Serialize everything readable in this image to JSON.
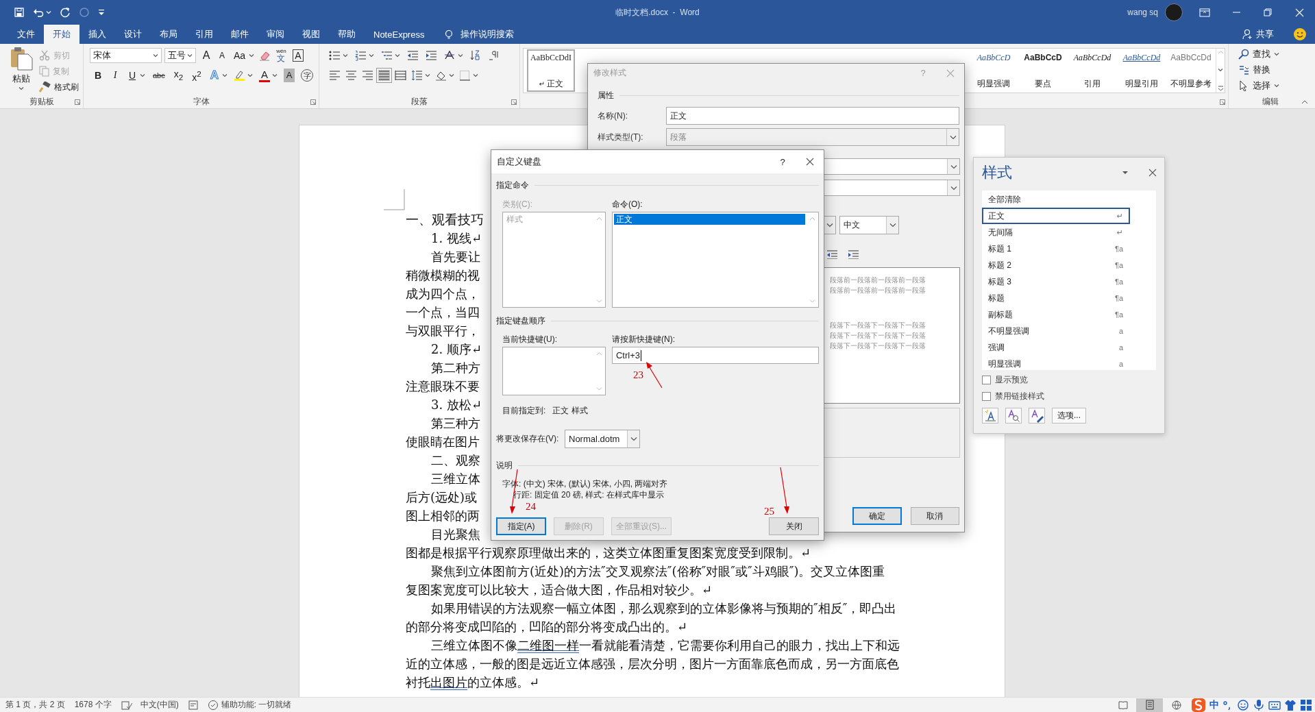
{
  "window": {
    "title": "临时文档.docx  -  Word",
    "user": "wang sq"
  },
  "tabs": [
    {
      "label": "文件",
      "selected": false
    },
    {
      "label": "开始",
      "selected": true
    },
    {
      "label": "插入",
      "selected": false
    },
    {
      "label": "设计",
      "selected": false
    },
    {
      "label": "布局",
      "selected": false
    },
    {
      "label": "引用",
      "selected": false
    },
    {
      "label": "邮件",
      "selected": false
    },
    {
      "label": "审阅",
      "selected": false
    },
    {
      "label": "视图",
      "selected": false
    },
    {
      "label": "帮助",
      "selected": false
    },
    {
      "label": "NoteExpress",
      "selected": false
    }
  ],
  "tell_me": "操作说明搜索",
  "share": "共享",
  "ribbon": {
    "clipboard": {
      "label": "剪贴板",
      "paste": "粘贴",
      "tools": [
        {
          "kind": "cut",
          "label": "剪切",
          "disabled": true
        },
        {
          "kind": "copy",
          "label": "复制",
          "disabled": true
        },
        {
          "kind": "painter",
          "label": "格式刷",
          "disabled": false
        }
      ]
    },
    "font": {
      "label": "字体",
      "name": "宋体",
      "size": "五号",
      "row1": [
        {
          "kind": "grow",
          "glyph": "A"
        },
        {
          "kind": "shrink",
          "glyph": "A"
        },
        {
          "kind": "case",
          "glyph": "Aa"
        },
        {
          "kind": "clear"
        },
        {
          "kind": "phonetic",
          "glyph": "wén",
          "base": "文"
        },
        {
          "kind": "border",
          "glyph": "A"
        }
      ],
      "row2": [
        {
          "kind": "bold",
          "glyph": "B"
        },
        {
          "kind": "italic",
          "glyph": "I"
        },
        {
          "kind": "underline",
          "glyph": "U"
        },
        {
          "kind": "strike",
          "glyph": "abc"
        },
        {
          "kind": "sub",
          "glyph": "x$_{2}$"
        },
        {
          "kind": "sup",
          "glyph": "x$^{2}$"
        },
        {
          "kind": "effects",
          "glyph": "A"
        },
        {
          "kind": "highlight"
        },
        {
          "kind": "color",
          "glyph": "A"
        },
        {
          "kind": "shading",
          "glyph": "A"
        },
        {
          "kind": "enclose",
          "glyph": "字"
        }
      ]
    },
    "paragraph": {
      "label": "段落",
      "alignments": [
        {
          "selected": false
        },
        {
          "selected": false
        },
        {
          "selected": false
        },
        {
          "selected": true
        },
        {
          "selected": false
        }
      ]
    },
    "styles": [
      {
        "kind": "normal",
        "sample": "AaBbCcDdI",
        "mark": "↵",
        "label": "正文",
        "selected": true
      },
      {
        "kind": "emphasis",
        "sample": "AaBbCcD",
        "label": "明显强调",
        "selected": false
      },
      {
        "kind": "strong",
        "sample": "AaBbCcD",
        "label": "要点",
        "selected": false
      },
      {
        "kind": "quote",
        "sample": "AaBbCcDd",
        "label": "引用",
        "selected": false
      },
      {
        "kind": "intense_quote",
        "sample": "AaBbCcDd",
        "label": "明显引用",
        "selected": false
      },
      {
        "kind": "subtle_ref",
        "sample": "AaBbCcDd",
        "label": "不明显参考",
        "selected": false
      }
    ],
    "editing": {
      "label": "编辑",
      "tools": [
        {
          "kind": "find",
          "label": "查找"
        },
        {
          "kind": "replace",
          "label": "替换"
        },
        {
          "kind": "select",
          "label": "选择"
        }
      ]
    }
  },
  "document": {
    "lines": [
      {
        "kind": "heading",
        "parts": [
          {
            "text": "一、观看技巧"
          }
        ]
      },
      {
        "kind": "indent",
        "parts": [
          {
            "text": "1. 视线↵"
          }
        ]
      },
      {
        "kind": "indent",
        "parts": [
          {
            "text": "首先要让"
          }
        ]
      },
      {
        "kind": "plain",
        "parts": [
          {
            "text": "稍微模糊的视"
          }
        ]
      },
      {
        "kind": "plain",
        "parts": [
          {
            "text": "成为四个点，"
          }
        ]
      },
      {
        "kind": "plain",
        "parts": [
          {
            "text": "一个点，当四"
          }
        ]
      },
      {
        "kind": "plain",
        "parts": [
          {
            "text": "与双眼平行，"
          }
        ]
      },
      {
        "kind": "indent",
        "parts": [
          {
            "text": "2. 顺序↵"
          }
        ]
      },
      {
        "kind": "indent",
        "parts": [
          {
            "text": "第二种方"
          }
        ]
      },
      {
        "kind": "plain",
        "parts": [
          {
            "text": "注意眼珠不要"
          }
        ]
      },
      {
        "kind": "indent",
        "parts": [
          {
            "text": "3. 放松↵"
          }
        ]
      },
      {
        "kind": "indent",
        "parts": [
          {
            "text": "第三种方"
          }
        ]
      },
      {
        "kind": "plain",
        "parts": [
          {
            "text": "使眼睛在图片"
          }
        ]
      },
      {
        "kind": "indent",
        "parts": [
          {
            "text": "二、观察"
          }
        ]
      },
      {
        "kind": "indent",
        "parts": [
          {
            "text": "三维立体"
          }
        ]
      },
      {
        "kind": "plain",
        "parts": [
          {
            "text": "后方(远处)或"
          }
        ]
      },
      {
        "kind": "plain",
        "parts": [
          {
            "text": "图上相邻的两"
          }
        ]
      },
      {
        "kind": "indent",
        "parts": [
          {
            "text": "目光聚焦"
          }
        ]
      },
      {
        "kind": "plain",
        "parts": [
          {
            "text": "图都是根据平行观察原理做出来的，这类立体图重复图案宽度受到限制。↵"
          }
        ]
      },
      {
        "kind": "indent",
        "parts": [
          {
            "text": "聚焦到立体图前方(近处)的方法″交叉观察法″(俗称″对眼″或″斗鸡眼″)。交叉立体图重"
          }
        ]
      },
      {
        "kind": "plain",
        "parts": [
          {
            "text": "复图案宽度可以比较大，适合做大图，作品相对较少。↵"
          }
        ]
      },
      {
        "kind": "indent",
        "parts": [
          {
            "text": "如果用错误的方法观察一幅立体图，那么观察到的立体影像将与预期的″相反″，即凸出"
          }
        ]
      },
      {
        "kind": "plain",
        "parts": [
          {
            "text": "的部分将变成凹陷的，凹陷的部分将变成凸出的。↵"
          }
        ]
      },
      {
        "kind": "indent",
        "parts": [
          {
            "text": "三维立体图不像"
          },
          {
            "text": "二维图一样",
            "marked": true
          },
          {
            "text": "一看就能看清楚，它需要你利用自己的眼力，找出上下和远"
          }
        ]
      },
      {
        "kind": "plain",
        "parts": [
          {
            "text": "近的立体感，一般的图是远近立体感强，层次分明，图片一方面靠底色而成，另一方面底色"
          }
        ]
      },
      {
        "kind": "plain",
        "parts": [
          {
            "text": "衬托"
          },
          {
            "text": "出图片",
            "marked": true
          },
          {
            "text": "的立体感。↵"
          }
        ]
      }
    ]
  },
  "modify_style_dialog": {
    "title": "修改样式",
    "help": "?",
    "section": "属性",
    "fields": [
      {
        "label": "名称(N):",
        "value": "正文",
        "kind": "text"
      },
      {
        "label": "样式类型(T):",
        "value": "段落",
        "kind": "dropdown"
      }
    ],
    "script_dropdown": "中文",
    "preview_before": [
      "段落前一段落前一段落前一段落",
      "段落前一段落前一段落前一段落"
    ],
    "preview_after": [
      "段落下一段落下一段落下一段落",
      "段落下一段落下一段落下一段落",
      "段落下一段落下一段落下一段落"
    ],
    "buttons": [
      {
        "label": "确定",
        "default": true
      },
      {
        "label": "取消",
        "default": false
      }
    ]
  },
  "keyboard_dialog": {
    "title": "自定义键盘",
    "help": "?",
    "command_section": "指定命令",
    "category": {
      "label": "类别(C):",
      "items": [
        "样式"
      ],
      "disabled": true
    },
    "commands": {
      "label": "命令(O):",
      "items": [
        {
          "label": "正文",
          "selected": true
        }
      ]
    },
    "sequence_section": "指定键盘顺序",
    "current_keys": {
      "label": "当前快捷键(U):"
    },
    "new_key": {
      "label": "请按新快捷键(N):",
      "value": "Ctrl+3"
    },
    "assigned_label": "目前指定到:",
    "assigned_value": "正文 样式",
    "save_label": "将更改保存在(V):",
    "save_value": "Normal.dotm",
    "description_section": "说明",
    "description": [
      "字体: (中文) 宋体, (默认) 宋体, 小四, 两端对齐",
      "行距: 固定值 20 磅, 样式: 在样式库中显示"
    ],
    "buttons": [
      {
        "label": "指定(A)",
        "disabled": false,
        "default": true
      },
      {
        "label": "删除(R)",
        "disabled": true,
        "default": false
      },
      {
        "label": "全部重设(S)...",
        "disabled": true,
        "default": false
      },
      {
        "label": "关闭",
        "disabled": false,
        "default": false
      }
    ],
    "annotations": [
      "23",
      "24",
      "25"
    ]
  },
  "styles_pane": {
    "title": "样式",
    "items": [
      {
        "label": "全部清除",
        "selected": false
      },
      {
        "label": "正文",
        "mark": "↵",
        "selected": true
      },
      {
        "label": "无间隔",
        "mark": "↵",
        "selected": false
      },
      {
        "label": "标题 1",
        "mark": "¶a",
        "selected": false
      },
      {
        "label": "标题 2",
        "mark": "¶a",
        "selected": false
      },
      {
        "label": "标题 3",
        "mark": "¶a",
        "selected": false
      },
      {
        "label": "标题",
        "mark": "¶a",
        "selected": false
      },
      {
        "label": "副标题",
        "mark": "¶a",
        "selected": false
      },
      {
        "label": "不明显强调",
        "mark": "a",
        "selected": false
      },
      {
        "label": "强调",
        "mark": "a",
        "selected": false
      },
      {
        "label": "明显强调",
        "mark": "a",
        "selected": false
      }
    ],
    "checkboxes": [
      {
        "label": "显示预览",
        "checked": false
      },
      {
        "label": "禁用链接样式",
        "checked": false
      }
    ],
    "options_button": "选项..."
  },
  "status_bar": {
    "page": "第 1 页，共 2 页",
    "words": "1678 个字",
    "language": "中文(中国)",
    "accessibility": "辅助功能: 一切就绪",
    "views": [
      {
        "selected": false
      },
      {
        "selected": true
      },
      {
        "selected": false
      }
    ],
    "ime": "中"
  }
}
